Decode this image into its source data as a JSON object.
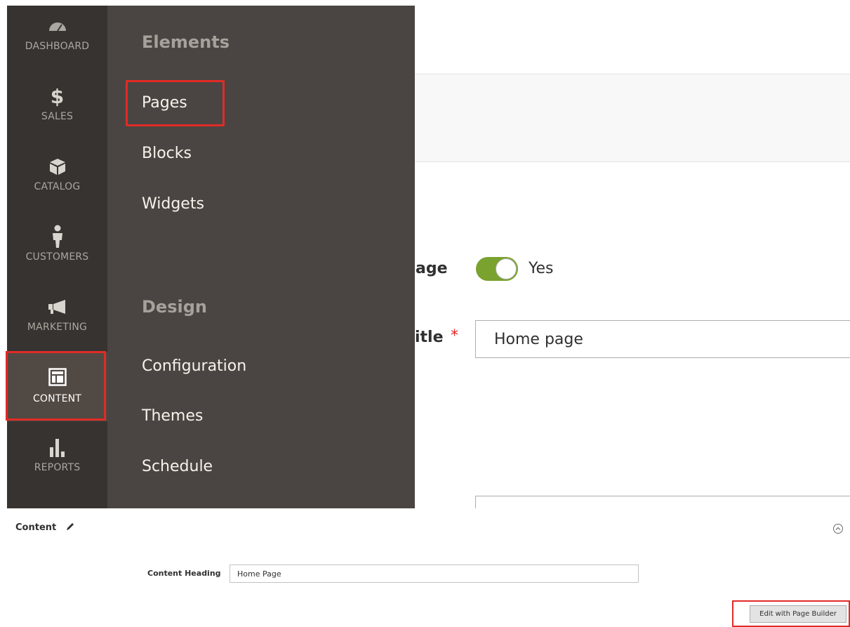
{
  "admin_nav": {
    "items": [
      {
        "label": "DASHBOARD",
        "icon": "dashboard-gauge-icon"
      },
      {
        "label": "SALES",
        "icon": "dollar-icon"
      },
      {
        "label": "CATALOG",
        "icon": "box-icon"
      },
      {
        "label": "CUSTOMERS",
        "icon": "person-icon"
      },
      {
        "label": "MARKETING",
        "icon": "megaphone-icon"
      },
      {
        "label": "CONTENT",
        "icon": "layout-icon",
        "active": true
      },
      {
        "label": "REPORTS",
        "icon": "bar-chart-icon"
      }
    ]
  },
  "flyout": {
    "groups": [
      {
        "title": "Elements",
        "links": [
          "Pages",
          "Blocks",
          "Widgets"
        ]
      },
      {
        "title": "Design",
        "links": [
          "Configuration",
          "Themes",
          "Schedule"
        ]
      }
    ]
  },
  "page_form": {
    "enable_label_fragment": "age",
    "enable_value": "Yes",
    "title_label_fragment": "itle",
    "required_mark": "*",
    "title_value": "Home page"
  },
  "content_section": {
    "title": "Content",
    "heading_label": "Content Heading",
    "heading_value": "Home Page",
    "edit_button_label": "Edit with Page Builder"
  },
  "colors": {
    "sidebar_bg": "#373330",
    "flyout_bg": "#4a4542",
    "highlight": "#e02b27",
    "toggle_on": "#79a22e"
  }
}
